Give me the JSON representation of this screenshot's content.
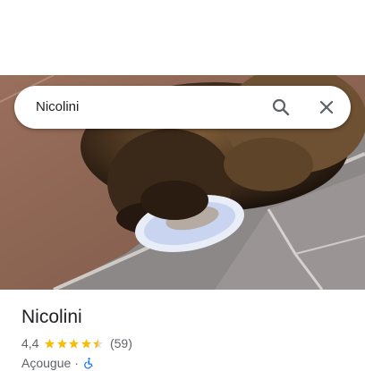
{
  "search": {
    "query": "Nicolini"
  },
  "place": {
    "name": "Nicolini",
    "rating": "4,4",
    "stars": 4.5,
    "reviews": "(59)",
    "category": "Açougue",
    "separator": "·",
    "accessibility_icon": "wheelchair-icon"
  },
  "icons": {
    "search": "search-icon",
    "close": "close-icon"
  },
  "colors": {
    "star": "#fbbc04",
    "text_primary": "#202124",
    "text_secondary": "#5f6368",
    "accessible": "#1a73e8"
  }
}
